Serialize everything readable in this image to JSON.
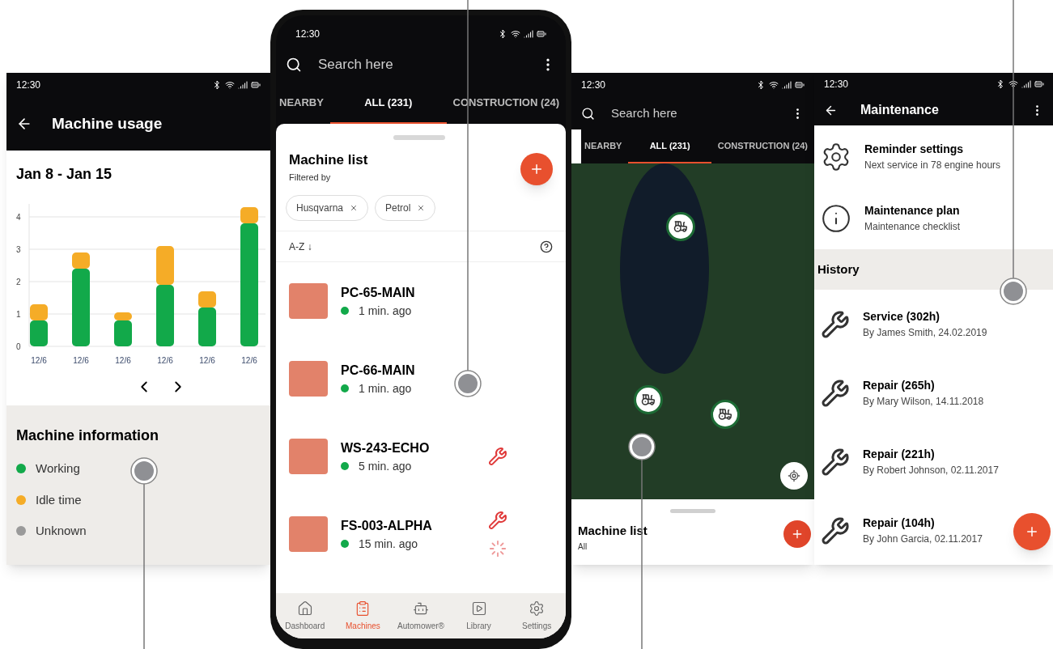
{
  "usage_screen": {
    "status_time": "12:30",
    "title": "Machine usage",
    "date_range": "Jan 8 - Jan 15",
    "chart_data": {
      "type": "bar",
      "stacked": true,
      "grid": true,
      "categories": [
        "12/6",
        "12/6",
        "12/6",
        "12/6",
        "12/6",
        "12/6"
      ],
      "yticks": [
        0,
        1,
        2,
        3,
        4
      ],
      "ylim": [
        0,
        4.4
      ],
      "series": [
        {
          "name": "Working",
          "color": "#12a94a",
          "values": [
            0.8,
            2.4,
            0.8,
            1.9,
            1.2,
            3.8
          ]
        },
        {
          "name": "Idle time",
          "color": "#f5ac27",
          "values": [
            0.5,
            0.5,
            0.25,
            1.2,
            0.5,
            0.5
          ]
        }
      ]
    },
    "info_title": "Machine information",
    "legend_extra": [
      {
        "label": "Unknown",
        "color": "#9a9a9a"
      }
    ]
  },
  "list_screen": {
    "status_time": "12:30",
    "search": {
      "placeholder": "Search here"
    },
    "tabs": [
      {
        "label": "NEARBY",
        "selected": false
      },
      {
        "label": "ALL (231)",
        "selected": true
      },
      {
        "label": "CONSTRUCTION (24)",
        "selected": false
      }
    ],
    "title": "Machine list",
    "subtitle": "Filtered by",
    "filters": [
      "Husqvarna",
      "Petrol"
    ],
    "sort": "A-Z ↓",
    "machines": [
      {
        "name": "PC-65-MAIN",
        "time": "1 min. ago",
        "service": false,
        "pending": false
      },
      {
        "name": "PC-66-MAIN",
        "time": "1 min. ago",
        "service": false,
        "pending": false
      },
      {
        "name": "WS-243-ECHO",
        "time": "5 min. ago",
        "service": true,
        "pending": false
      },
      {
        "name": "FS-003-ALPHA",
        "time": "15 min. ago",
        "service": true,
        "pending": true
      }
    ],
    "nav": [
      {
        "label": "Dashboard",
        "kind": "home",
        "selected": false
      },
      {
        "label": "Machines",
        "kind": "list",
        "selected": true
      },
      {
        "label": "Automower®",
        "kind": "robot",
        "selected": false
      },
      {
        "label": "Library",
        "kind": "library",
        "selected": false
      },
      {
        "label": "Settings",
        "kind": "settings",
        "selected": false
      }
    ]
  },
  "map_screen": {
    "status_time": "12:30",
    "search": {
      "placeholder": "Search here"
    },
    "tabs": [
      {
        "label": "NEARBY",
        "selected": false
      },
      {
        "label": "ALL (231)",
        "selected": true
      },
      {
        "label": "CONSTRUCTION (24)",
        "selected": false
      }
    ],
    "sheet_title": "Machine list",
    "sheet_subtitle": "All"
  },
  "maintenance_screen": {
    "status_time": "12:30",
    "title": "Maintenance",
    "settings": [
      {
        "kind": "gear",
        "title": "Reminder settings",
        "subtitle": "Next service in 78 engine hours"
      },
      {
        "kind": "info",
        "title": "Maintenance plan",
        "subtitle": "Maintenance checklist"
      }
    ],
    "history_title": "History",
    "history": [
      {
        "title": "Service (302h)",
        "subtitle": "By James Smith, 24.02.2019"
      },
      {
        "title": "Repair (265h)",
        "subtitle": "By Mary Wilson, 14.11.2018"
      },
      {
        "title": "Repair (221h)",
        "subtitle": "By Robert Johnson, 02.11.2017"
      },
      {
        "title": "Repair (104h)",
        "subtitle": "By John Garcia, 02.11.2017"
      }
    ]
  }
}
